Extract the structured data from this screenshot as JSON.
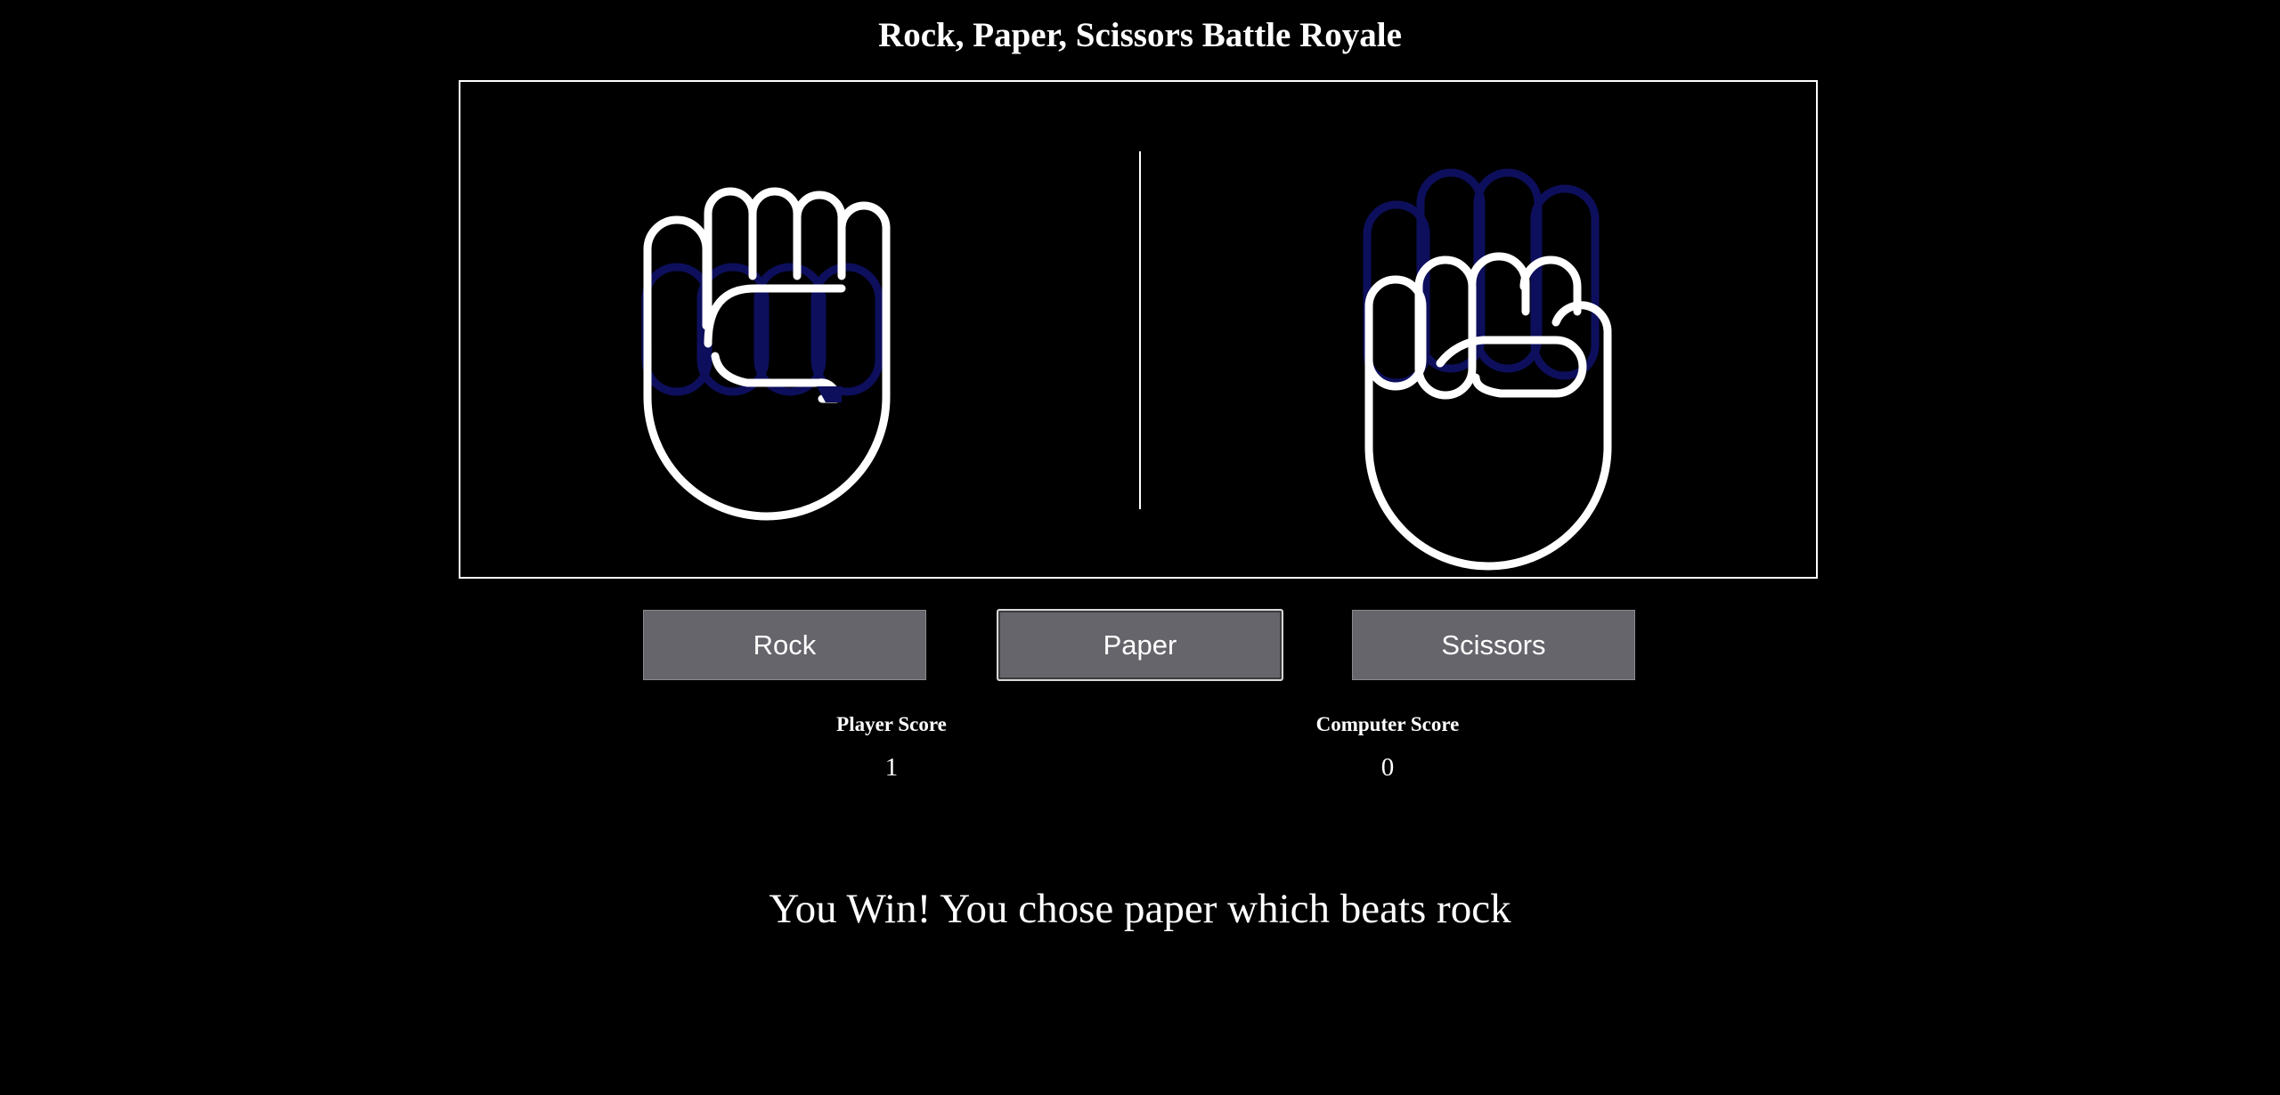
{
  "title": "Rock, Paper, Scissors Battle Royale",
  "arena": {
    "player_hand": "rock-hand-icon",
    "computer_hand": "rock-hand-icon"
  },
  "buttons": {
    "rock": "Rock",
    "paper": "Paper",
    "scissors": "Scissors"
  },
  "scores": {
    "player_label": "Player Score",
    "player_value": "1",
    "computer_label": "Computer Score",
    "computer_value": "0"
  },
  "result": "You Win! You chose paper which beats rock",
  "colors": {
    "background": "#000000",
    "button": "#66656b",
    "ghost_outline": "#0d0f5c",
    "foreground": "#ffffff"
  }
}
